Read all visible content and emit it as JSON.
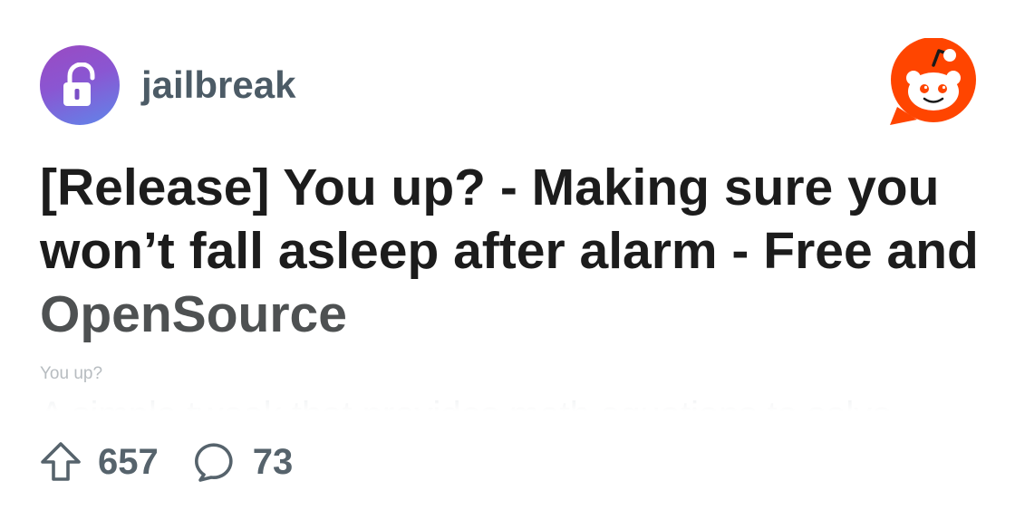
{
  "community": {
    "name": "jailbreak",
    "avatar_icon": "unlocked-padlock-icon",
    "avatar_gradient": [
      "#9a4ac2",
      "#5f86ea"
    ]
  },
  "brand": {
    "logo_icon": "reddit-snoo-icon",
    "accent_color": "#ff4500"
  },
  "post": {
    "title_lines": [
      "[Release] You up? - Making sure you",
      "won’t fall asleep after alarm - Free and",
      "OpenSource"
    ],
    "flair": "You up?",
    "body_preview": "A simple tweak that provides math equations to solve"
  },
  "stats": {
    "upvotes": "657",
    "comments": "73",
    "upvote_icon": "upvote-arrow-icon",
    "comment_icon": "comment-bubble-icon"
  }
}
